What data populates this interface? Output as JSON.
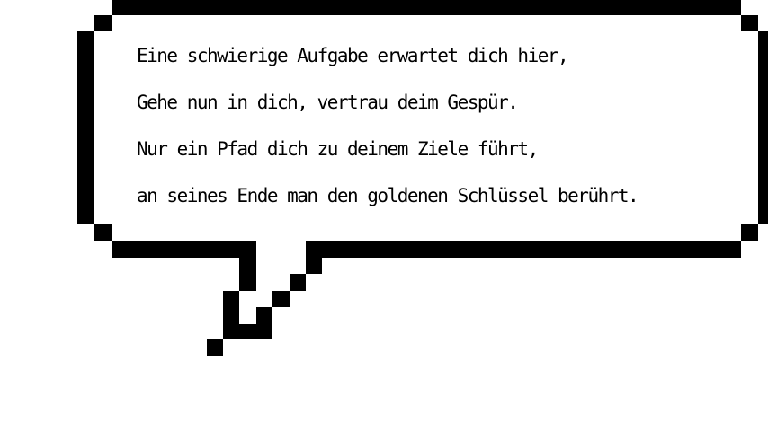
{
  "speech_bubble": {
    "lines": [
      "Eine schwierige Aufgabe erwartet dich hier,",
      "Gehe nun in dich, vertrau deim Gespür.",
      "Nur ein Pfad dich zu deinem Ziele führt,",
      "an seines Ende man den goldenen Schlüssel berührt."
    ]
  },
  "colors": {
    "outline": "#000000",
    "fill": "#ffffff",
    "text": "#000000"
  }
}
